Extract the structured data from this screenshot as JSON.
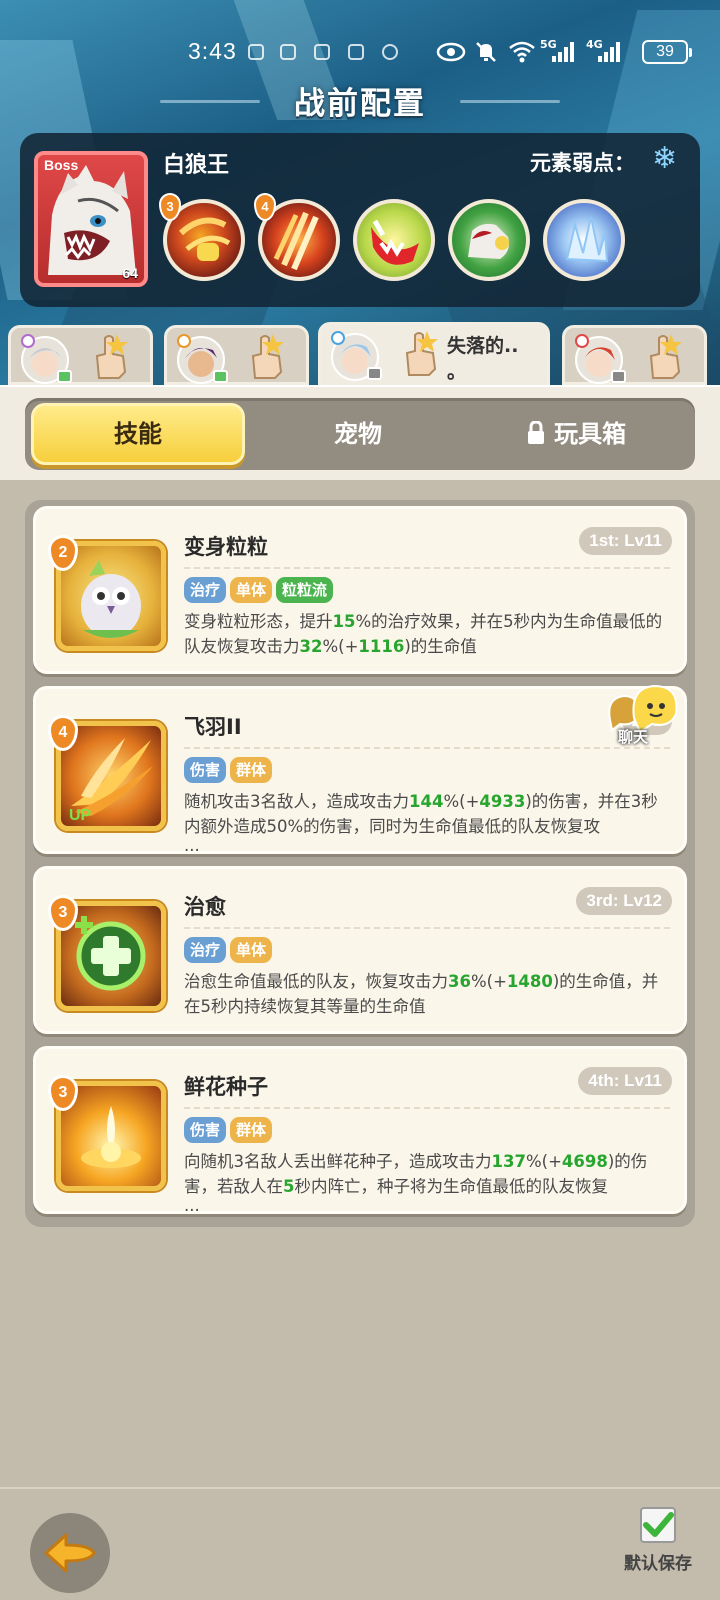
{
  "status_bar": {
    "time": "3:43",
    "net1": "5G",
    "net2": "4G",
    "battery": "39"
  },
  "header": {
    "title": "战前配置"
  },
  "boss": {
    "tag": "Boss",
    "name": "白狼王",
    "level": "64",
    "weakness_label": "元素弱点：",
    "weakness_icon": "snowflake-icon",
    "skills": [
      {
        "badge": "3",
        "icon": "claw-strike-icon"
      },
      {
        "badge": "4",
        "icon": "triple-slash-icon"
      },
      {
        "badge": "",
        "icon": "fang-bite-icon"
      },
      {
        "badge": "",
        "icon": "wolf-howl-icon"
      },
      {
        "badge": "",
        "icon": "ice-crystal-icon"
      }
    ]
  },
  "heroes": {
    "active_label_line1": "失落的..",
    "active_label_line2": "。"
  },
  "tabs": {
    "skills": "技能",
    "pets": "宠物",
    "toybox": "玩具箱"
  },
  "skills": [
    {
      "badge": "2",
      "name": "变身粒粒",
      "rank": "1st: Lv11",
      "tags": [
        "治疗",
        "单体",
        "粒粒流"
      ],
      "desc": {
        "p1": "变身粒粒形态，提升",
        "v1": "15",
        "p2": "%的治疗效果，并在5秒内为生命值最低的队友恢复攻击力",
        "v2": "32",
        "p3": "%(+",
        "v3": "1116",
        "p4": ")的生命值"
      }
    },
    {
      "badge": "4",
      "name": "飞羽II",
      "rank": "2nd",
      "up": "UP",
      "tags": [
        "伤害",
        "群体"
      ],
      "desc": {
        "p1": "随机攻击3名敌人，造成攻击力",
        "v1": "144",
        "p2": "%(+",
        "v2": "4933",
        "p3": ")的伤害，并在3秒内额外造成50%的伤害，同时为生命值最低的队友恢复攻",
        "ell": "..."
      }
    },
    {
      "badge": "3",
      "name": "治愈",
      "rank": "3rd: Lv12",
      "tags": [
        "治疗",
        "单体"
      ],
      "desc": {
        "p1": "治愈生命值最低的队友，恢复攻击力",
        "v1": "36",
        "p2": "%(+",
        "v2": "1480",
        "p3": ")的生命值，并在5秒内持续恢复其等量的生命值"
      }
    },
    {
      "badge": "3",
      "name": "鲜花种子",
      "rank": "4th: Lv11",
      "tags": [
        "伤害",
        "群体"
      ],
      "desc": {
        "p1": "向随机3名敌人丢出鲜花种子，造成攻击力",
        "v1": "137",
        "p2": "%(+",
        "v2": "4698",
        "p3": ")的伤害，若敌人在",
        "v3": "5",
        "p4": "秒内阵亡，种子将为生命值最低的队友恢复",
        "ell": "..."
      }
    }
  ],
  "chat": {
    "label": "聊天"
  },
  "footer": {
    "save_label": "默认保存"
  }
}
